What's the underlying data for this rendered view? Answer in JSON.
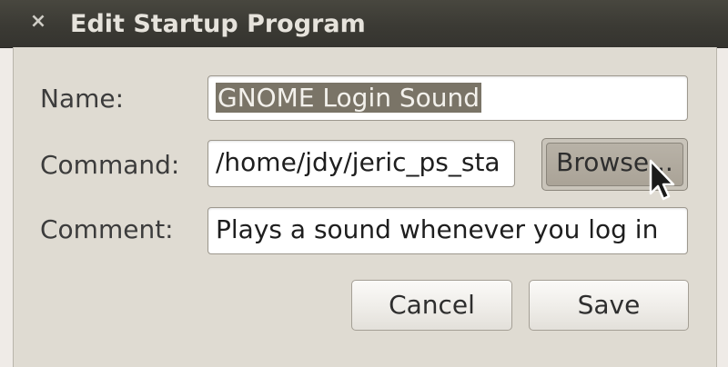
{
  "window": {
    "title": "Edit Startup Program",
    "close_glyph": "×"
  },
  "form": {
    "name_label": "Name:",
    "name_value": "GNOME Login Sound",
    "command_label": "Command:",
    "command_value": "/home/jdy/jeric_ps_sta",
    "comment_label": "Comment:",
    "comment_value": "Plays a sound whenever you log in"
  },
  "buttons": {
    "browse": "Browse...",
    "cancel": "Cancel",
    "save": "Save"
  },
  "icons": {
    "close": "close-icon",
    "cursor": "mouse-pointer-icon"
  },
  "colors": {
    "titlebar": "#3b3a34",
    "selection": "#7a7467",
    "dialog_bg": "#dfdbd2"
  }
}
